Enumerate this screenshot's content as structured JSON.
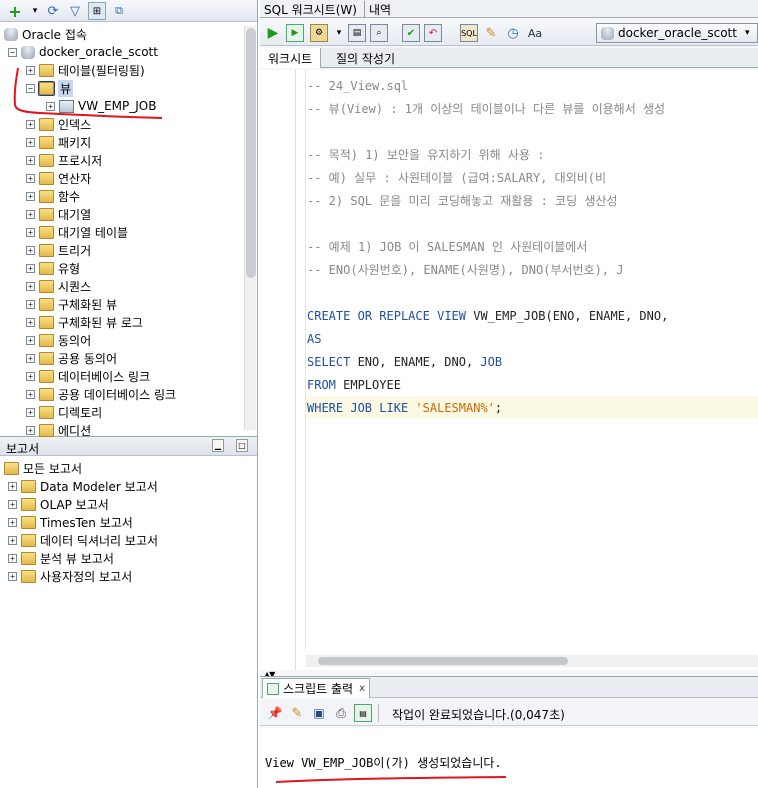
{
  "navigator": {
    "root_label": "Oracle 접속",
    "connection_label": "docker_oracle_scott",
    "items": [
      {
        "label": "테이블(필터링됨)"
      },
      {
        "label": "뷰"
      },
      {
        "label": "VW_EMP_JOB"
      },
      {
        "label": "인덱스"
      },
      {
        "label": "패키지"
      },
      {
        "label": "프로시저"
      },
      {
        "label": "연산자"
      },
      {
        "label": "함수"
      },
      {
        "label": "대기열"
      },
      {
        "label": "대기열 테이블"
      },
      {
        "label": "트리거"
      },
      {
        "label": "유형"
      },
      {
        "label": "시퀀스"
      },
      {
        "label": "구체화된 뷰"
      },
      {
        "label": "구체화된 뷰 로그"
      },
      {
        "label": "동의어"
      },
      {
        "label": "공용 동의어"
      },
      {
        "label": "데이터베이스 링크"
      },
      {
        "label": "공용 데이터베이스 링크"
      },
      {
        "label": "디렉토리"
      },
      {
        "label": "에디션"
      }
    ]
  },
  "reports": {
    "panel_title": "보고서",
    "root_label": "모든 보고서",
    "items": [
      {
        "label": "Data Modeler 보고서"
      },
      {
        "label": "OLAP 보고서"
      },
      {
        "label": "TimesTen 보고서"
      },
      {
        "label": "데이터 딕셔너리 보고서"
      },
      {
        "label": "분석 뷰 보고서"
      },
      {
        "label": "사용자정의 보고서"
      }
    ]
  },
  "top_tabs": {
    "worksheet": "SQL 워크시트(W)",
    "history": "내역"
  },
  "connection_select": "docker_oracle_scott",
  "sub_tabs": {
    "worksheet": "워크시트",
    "query_builder": "질의 작성기"
  },
  "code_lines": [
    {
      "text": "-- 24_View.sql"
    },
    {
      "text": "-- 뷰(View) : 1개 이상의 테이블이나 다른 뷰를 이용해서 생성"
    },
    {
      "text": ""
    },
    {
      "text": "-- 목적) 1) 보안을 유지하기 위해 사용 :"
    },
    {
      "text": "--          예) 실무 : 사원테이블 (급여:SALARY, 대외비(비"
    },
    {
      "text": "--       2) SQL 문을 미리 코딩해놓고 재활용 : 코딩 생산성"
    },
    {
      "text": ""
    },
    {
      "text": "-- 예제 1) JOB 이 SALESMAN 인 사원테이블에서"
    },
    {
      "text": "--        ENO(사원번호), ENAME(사원명), DNO(부서번호), J"
    },
    {
      "text": ""
    },
    {
      "text": "CREATE OR REPLACE VIEW VW_EMP_JOB(ENO, ENAME, DNO,"
    },
    {
      "text": "AS"
    },
    {
      "text": "SELECT ENO, ENAME, DNO, JOB"
    },
    {
      "text": "FROM EMPLOYEE"
    },
    {
      "text": "WHERE JOB LIKE 'SALESMAN%';"
    }
  ],
  "code_tokens": {
    "create": "CREATE",
    "or": "OR",
    "replace": "REPLACE",
    "view": "VIEW",
    "create_rest": " VW_EMP_JOB(ENO, ENAME, DNO,",
    "as": "AS",
    "select": "SELECT",
    "select_rest": " ENO, ENAME, DNO, ",
    "job": "JOB",
    "from": "FROM",
    "from_rest": " EMPLOYEE",
    "where": "WHERE",
    "job2": "JOB",
    "like": "LIKE",
    "salesman": "'SALESMAN%'",
    "semi": ";"
  },
  "output": {
    "tab_label": "스크립트 출력",
    "close_glyph": "x",
    "status": "작업이 완료되었습니다.(0,047초)",
    "message": "View VW_EMP_JOB이(가) 생성되었습니다."
  },
  "colors": {
    "annotation_red": "#e3141b",
    "keyword_blue": "#1f4fa6",
    "string_orange": "#cc6a00"
  }
}
